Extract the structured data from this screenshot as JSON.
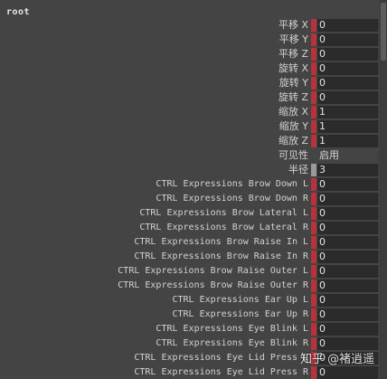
{
  "root_label": "root",
  "rows": [
    {
      "label": "平移 X",
      "value": "0",
      "marker": "red"
    },
    {
      "label": "平移 Y",
      "value": "0",
      "marker": "red"
    },
    {
      "label": "平移 Z",
      "value": "0",
      "marker": "red"
    },
    {
      "label": "旋转 X",
      "value": "0",
      "marker": "red"
    },
    {
      "label": "旋转 Y",
      "value": "0",
      "marker": "red"
    },
    {
      "label": "旋转 Z",
      "value": "0",
      "marker": "red"
    },
    {
      "label": "缩放 X",
      "value": "1",
      "marker": "red"
    },
    {
      "label": "缩放 Y",
      "value": "1",
      "marker": "red"
    },
    {
      "label": "缩放 Z",
      "value": "1",
      "marker": "red"
    },
    {
      "label": "可见性",
      "value": "启用",
      "marker": "none"
    },
    {
      "label": "半径",
      "value": "3",
      "marker": "gray"
    },
    {
      "label": "CTRL Expressions Brow Down L",
      "value": "0",
      "marker": "red"
    },
    {
      "label": "CTRL Expressions Brow Down R",
      "value": "0",
      "marker": "red"
    },
    {
      "label": "CTRL Expressions Brow Lateral L",
      "value": "0",
      "marker": "red"
    },
    {
      "label": "CTRL Expressions Brow Lateral R",
      "value": "0",
      "marker": "red"
    },
    {
      "label": "CTRL Expressions Brow Raise In L",
      "value": "0",
      "marker": "red"
    },
    {
      "label": "CTRL Expressions Brow Raise In R",
      "value": "0",
      "marker": "red"
    },
    {
      "label": "CTRL Expressions Brow Raise Outer L",
      "value": "0",
      "marker": "red"
    },
    {
      "label": "CTRL Expressions Brow Raise Outer R",
      "value": "0",
      "marker": "red"
    },
    {
      "label": "CTRL Expressions Ear Up L",
      "value": "0",
      "marker": "red"
    },
    {
      "label": "CTRL Expressions Ear Up R",
      "value": "0",
      "marker": "red"
    },
    {
      "label": "CTRL Expressions Eye Blink L",
      "value": "0",
      "marker": "red"
    },
    {
      "label": "CTRL Expressions Eye Blink R",
      "value": "0",
      "marker": "red"
    },
    {
      "label": "CTRL Expressions Eye Lid Press L",
      "value": "0",
      "marker": "red"
    },
    {
      "label": "CTRL Expressions Eye Lid Press R",
      "value": "0",
      "marker": "red"
    }
  ],
  "watermark": "知乎 @褚逍遥",
  "colors": {
    "background": "#444444",
    "field": "#2b2b2b",
    "keyed_marker": "#b7323a",
    "neutral_marker": "#9a9a9a"
  }
}
